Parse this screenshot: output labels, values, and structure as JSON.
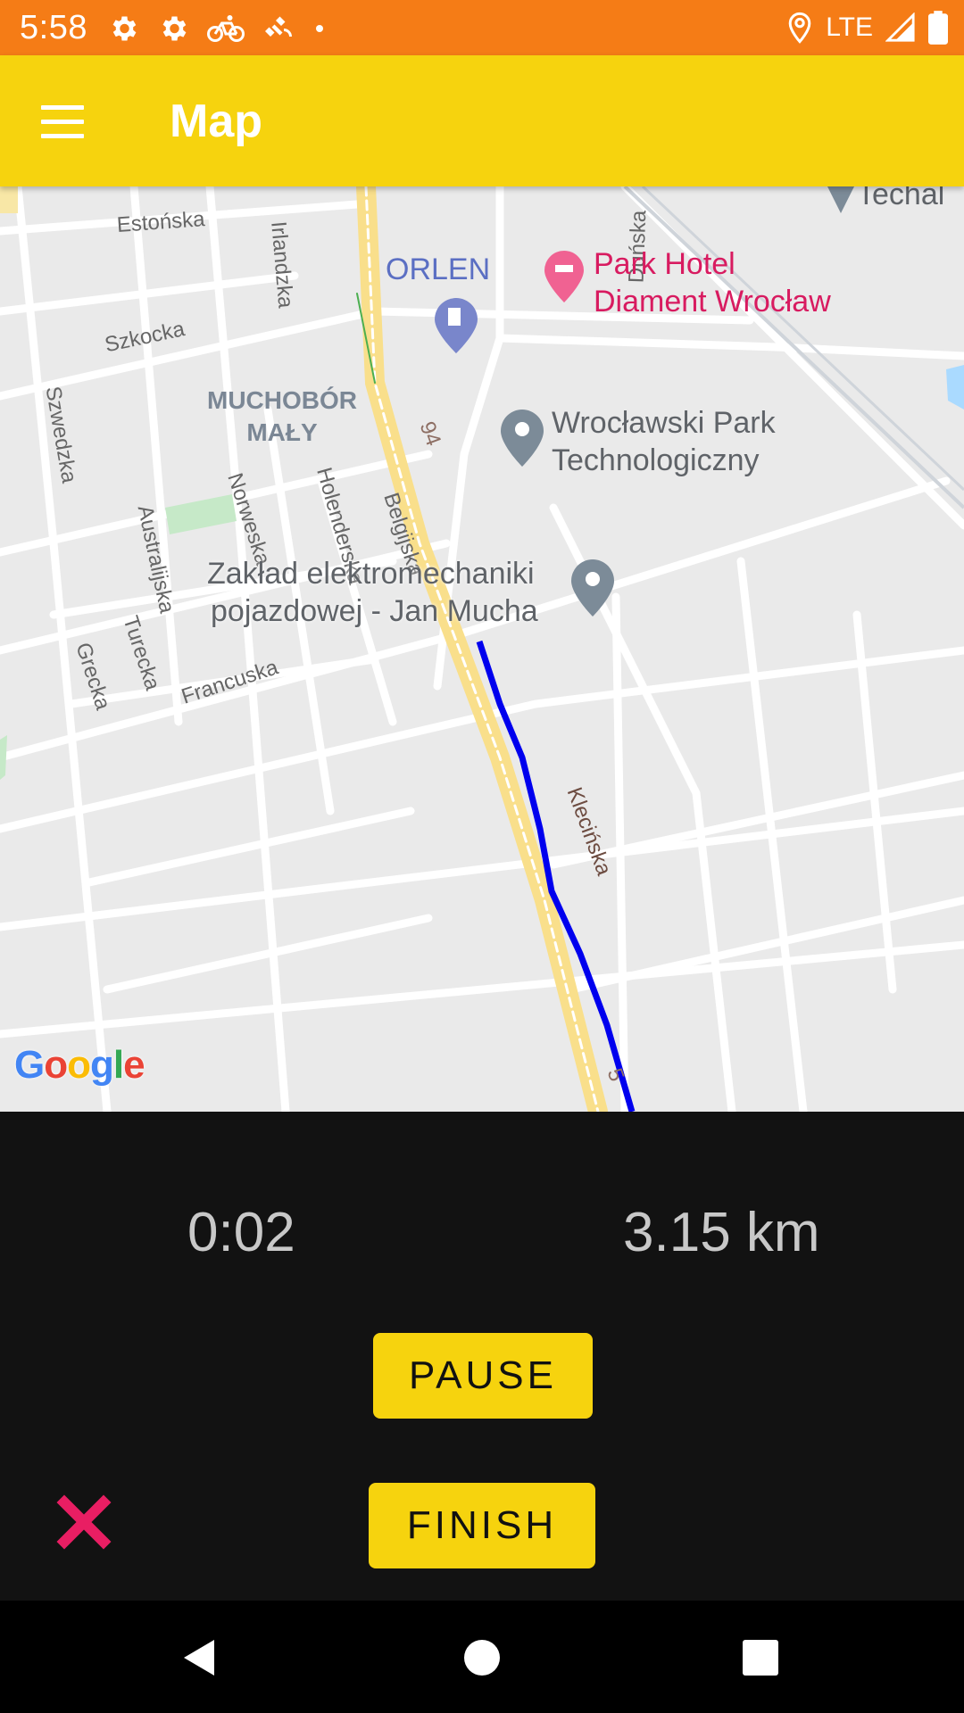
{
  "status_bar": {
    "time": "5:58",
    "network": "LTE",
    "left_icons": [
      "settings-icon",
      "settings-icon",
      "bicycle-icon",
      "satellite-icon",
      "dot-icon"
    ],
    "right_icons": [
      "location-icon",
      "signal-icon",
      "battery-icon"
    ]
  },
  "app_bar": {
    "title": "Map",
    "menu_icon": "menu-icon"
  },
  "map": {
    "streets": [
      "Estońska",
      "Irlandzka",
      "Duńska",
      "Szkocka",
      "Szwedzka",
      "Norweska",
      "Holenderska",
      "Belgijska",
      "Australijska",
      "Turecka",
      "Grecka",
      "Francuska",
      "Klecińska",
      "94",
      "5"
    ],
    "district": [
      "MUCHOBÓR",
      "MAŁY"
    ],
    "pois": {
      "top_right": "Techal",
      "fuel": "ORLEN",
      "hotel_line1": "Park Hotel",
      "hotel_line2": "Diament Wrocław",
      "park_line1": "Wrocławski Park",
      "park_line2": "Technologiczny",
      "zaklad_line1": "Zakład elektromechaniki",
      "zaklad_line2": "pojazdowej - Jan Mucha"
    },
    "attribution": "Google",
    "route_color": "#0000EE"
  },
  "stats": {
    "time": "0:02",
    "distance": "3.15 km"
  },
  "buttons": {
    "pause": "PAUSE",
    "finish": "FINISH",
    "cancel_icon": "close-icon"
  },
  "nav_bar": {
    "icons": [
      "back-icon",
      "home-icon",
      "recents-icon"
    ]
  },
  "colors": {
    "status_bar": "#F57C16",
    "app_bar": "#F6D30E",
    "panel": "#121212",
    "button": "#F6D30E",
    "cancel": "#E91E63"
  }
}
